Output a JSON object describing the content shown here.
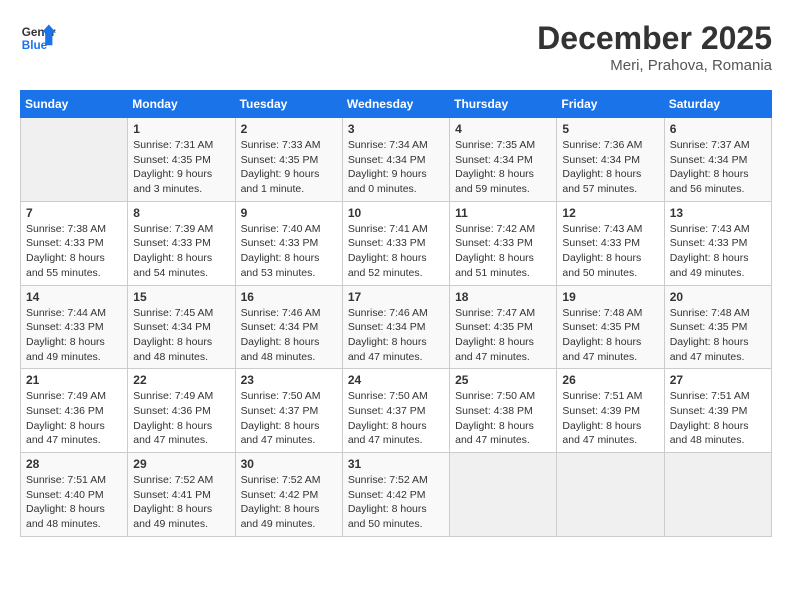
{
  "header": {
    "logo_line1": "General",
    "logo_line2": "Blue",
    "month": "December 2025",
    "location": "Meri, Prahova, Romania"
  },
  "days_of_week": [
    "Sunday",
    "Monday",
    "Tuesday",
    "Wednesday",
    "Thursday",
    "Friday",
    "Saturday"
  ],
  "weeks": [
    [
      {
        "day": "",
        "info": ""
      },
      {
        "day": "1",
        "info": "Sunrise: 7:31 AM\nSunset: 4:35 PM\nDaylight: 9 hours\nand 3 minutes."
      },
      {
        "day": "2",
        "info": "Sunrise: 7:33 AM\nSunset: 4:35 PM\nDaylight: 9 hours\nand 1 minute."
      },
      {
        "day": "3",
        "info": "Sunrise: 7:34 AM\nSunset: 4:34 PM\nDaylight: 9 hours\nand 0 minutes."
      },
      {
        "day": "4",
        "info": "Sunrise: 7:35 AM\nSunset: 4:34 PM\nDaylight: 8 hours\nand 59 minutes."
      },
      {
        "day": "5",
        "info": "Sunrise: 7:36 AM\nSunset: 4:34 PM\nDaylight: 8 hours\nand 57 minutes."
      },
      {
        "day": "6",
        "info": "Sunrise: 7:37 AM\nSunset: 4:34 PM\nDaylight: 8 hours\nand 56 minutes."
      }
    ],
    [
      {
        "day": "7",
        "info": "Sunrise: 7:38 AM\nSunset: 4:33 PM\nDaylight: 8 hours\nand 55 minutes."
      },
      {
        "day": "8",
        "info": "Sunrise: 7:39 AM\nSunset: 4:33 PM\nDaylight: 8 hours\nand 54 minutes."
      },
      {
        "day": "9",
        "info": "Sunrise: 7:40 AM\nSunset: 4:33 PM\nDaylight: 8 hours\nand 53 minutes."
      },
      {
        "day": "10",
        "info": "Sunrise: 7:41 AM\nSunset: 4:33 PM\nDaylight: 8 hours\nand 52 minutes."
      },
      {
        "day": "11",
        "info": "Sunrise: 7:42 AM\nSunset: 4:33 PM\nDaylight: 8 hours\nand 51 minutes."
      },
      {
        "day": "12",
        "info": "Sunrise: 7:43 AM\nSunset: 4:33 PM\nDaylight: 8 hours\nand 50 minutes."
      },
      {
        "day": "13",
        "info": "Sunrise: 7:43 AM\nSunset: 4:33 PM\nDaylight: 8 hours\nand 49 minutes."
      }
    ],
    [
      {
        "day": "14",
        "info": "Sunrise: 7:44 AM\nSunset: 4:33 PM\nDaylight: 8 hours\nand 49 minutes."
      },
      {
        "day": "15",
        "info": "Sunrise: 7:45 AM\nSunset: 4:34 PM\nDaylight: 8 hours\nand 48 minutes."
      },
      {
        "day": "16",
        "info": "Sunrise: 7:46 AM\nSunset: 4:34 PM\nDaylight: 8 hours\nand 48 minutes."
      },
      {
        "day": "17",
        "info": "Sunrise: 7:46 AM\nSunset: 4:34 PM\nDaylight: 8 hours\nand 47 minutes."
      },
      {
        "day": "18",
        "info": "Sunrise: 7:47 AM\nSunset: 4:35 PM\nDaylight: 8 hours\nand 47 minutes."
      },
      {
        "day": "19",
        "info": "Sunrise: 7:48 AM\nSunset: 4:35 PM\nDaylight: 8 hours\nand 47 minutes."
      },
      {
        "day": "20",
        "info": "Sunrise: 7:48 AM\nSunset: 4:35 PM\nDaylight: 8 hours\nand 47 minutes."
      }
    ],
    [
      {
        "day": "21",
        "info": "Sunrise: 7:49 AM\nSunset: 4:36 PM\nDaylight: 8 hours\nand 47 minutes."
      },
      {
        "day": "22",
        "info": "Sunrise: 7:49 AM\nSunset: 4:36 PM\nDaylight: 8 hours\nand 47 minutes."
      },
      {
        "day": "23",
        "info": "Sunrise: 7:50 AM\nSunset: 4:37 PM\nDaylight: 8 hours\nand 47 minutes."
      },
      {
        "day": "24",
        "info": "Sunrise: 7:50 AM\nSunset: 4:37 PM\nDaylight: 8 hours\nand 47 minutes."
      },
      {
        "day": "25",
        "info": "Sunrise: 7:50 AM\nSunset: 4:38 PM\nDaylight: 8 hours\nand 47 minutes."
      },
      {
        "day": "26",
        "info": "Sunrise: 7:51 AM\nSunset: 4:39 PM\nDaylight: 8 hours\nand 47 minutes."
      },
      {
        "day": "27",
        "info": "Sunrise: 7:51 AM\nSunset: 4:39 PM\nDaylight: 8 hours\nand 48 minutes."
      }
    ],
    [
      {
        "day": "28",
        "info": "Sunrise: 7:51 AM\nSunset: 4:40 PM\nDaylight: 8 hours\nand 48 minutes."
      },
      {
        "day": "29",
        "info": "Sunrise: 7:52 AM\nSunset: 4:41 PM\nDaylight: 8 hours\nand 49 minutes."
      },
      {
        "day": "30",
        "info": "Sunrise: 7:52 AM\nSunset: 4:42 PM\nDaylight: 8 hours\nand 49 minutes."
      },
      {
        "day": "31",
        "info": "Sunrise: 7:52 AM\nSunset: 4:42 PM\nDaylight: 8 hours\nand 50 minutes."
      },
      {
        "day": "",
        "info": ""
      },
      {
        "day": "",
        "info": ""
      },
      {
        "day": "",
        "info": ""
      }
    ]
  ]
}
